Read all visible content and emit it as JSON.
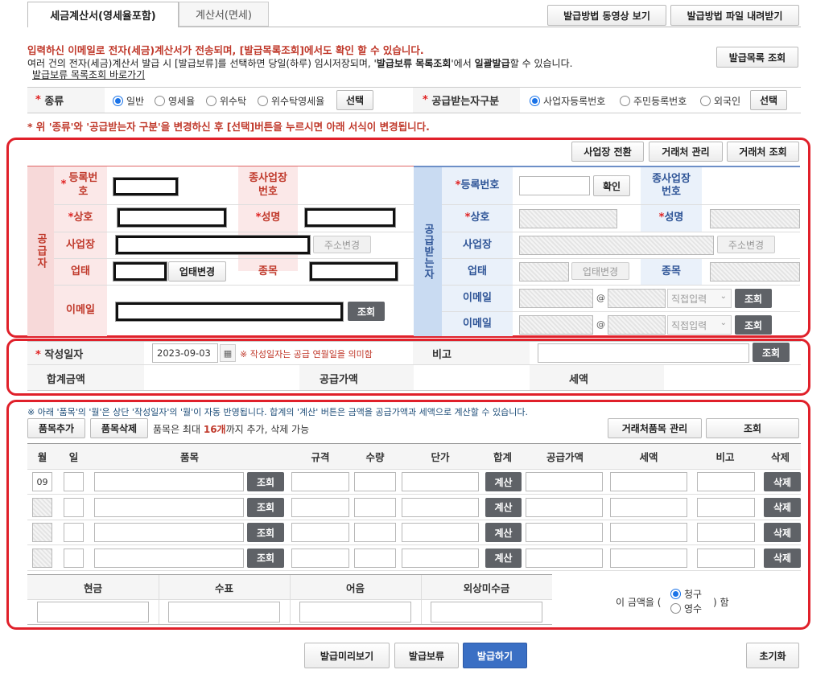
{
  "tabs": [
    {
      "label": "세금계산서(영세율포함)"
    },
    {
      "label": "계산서(면세)"
    }
  ],
  "top_buttons": {
    "video": "발급방법 동영상 보기",
    "download": "발급방법 파일 내려받기",
    "list": "발급목록 조회"
  },
  "notice": {
    "line1": "입력하신 이메일로 전자(세금)계산서가 전송되며, [발급목록조회]에서도 확인 할 수 있습니다.",
    "line2a": "여러 건의 전자(세금)계산서 발급 시 [발급보류]를 선택하면 당일(하루) 임시저장되며, '",
    "line2b": "발급보류 목록조회",
    "line2c": "'에서 ",
    "line2d": "일괄발급",
    "line2e": "할 수 있습니다.",
    "link": "발급보류 목록조회 바로가기"
  },
  "type_row": {
    "label": "종류",
    "options": [
      "일반",
      "영세율",
      "위수탁",
      "위수탁영세율"
    ],
    "selected": "일반",
    "select_button": "선택"
  },
  "receiver_type": {
    "label": "공급받는자구분",
    "options": [
      "사업자등록번호",
      "주민등록번호",
      "외국인"
    ],
    "selected": "사업자등록번호",
    "select_button": "선택"
  },
  "warning": "* 위 '종류'와 '공급받는자 구분'을 변경하신 후 [선택]버튼을 누르시면 아래 서식이 변경됩니다.",
  "party_buttons": {
    "switch": "사업장 전환",
    "manage": "거래처 관리",
    "lookup": "거래처 조회"
  },
  "supplier": {
    "side_label": "공급자",
    "reg_no": "등록번호",
    "sub_no": "종사업장번호",
    "name": "상호",
    "ceo": "성명",
    "address": "사업장",
    "addr_change": "주소변경",
    "biz_type": "업태",
    "biz_change": "업태변경",
    "item": "종목",
    "email": "이메일",
    "lookup": "조회"
  },
  "buyer": {
    "side_label": "공급받는자",
    "reg_no": "등록번호",
    "confirm": "확인",
    "sub_no": "종사업장번호",
    "name": "상호",
    "ceo": "성명",
    "address": "사업장",
    "addr_change": "주소변경",
    "biz_type": "업태",
    "biz_change": "업태변경",
    "item": "종목",
    "email": "이메일",
    "at": "@",
    "domain_select": "직접입력",
    "lookup": "조회"
  },
  "date_row": {
    "label": "작성일자",
    "value": "2023-09-03",
    "note": "※ 작성일자는 공급 연월일을 의미함",
    "remark": "비고",
    "lookup": "조회"
  },
  "sum_row": {
    "total": "합계금액",
    "supply": "공급가액",
    "tax": "세액"
  },
  "items": {
    "notice": "※ 아래 '품목'의 '월'은 상단 '작성일자'의 '월'이 자동 반영됩니다. 합계의 '계산' 버튼은 금액을 공급가액과 세액으로 계산할 수 있습니다.",
    "add": "품목추가",
    "remove": "품목삭제",
    "limit_a": "품목은 최대 ",
    "limit_b": "16개",
    "limit_c": "까지 추가, 삭제 가능",
    "manage": "거래처품목 관리",
    "lookup": "조회",
    "headers": [
      "월",
      "일",
      "품목",
      "규격",
      "수량",
      "단가",
      "합계",
      "공급가액",
      "세액",
      "비고",
      "삭제"
    ],
    "rows": [
      {
        "month": "09"
      },
      {
        "month": ""
      },
      {
        "month": ""
      },
      {
        "month": ""
      }
    ],
    "calc": "계산",
    "delete": "삭제"
  },
  "payment": {
    "headers": [
      "현금",
      "수표",
      "어음",
      "외상미수금"
    ],
    "prefix": "이 금액을 (",
    "options": [
      "청구",
      "영수"
    ],
    "selected": "청구",
    "suffix": ") 함"
  },
  "bottom": {
    "preview": "발급미리보기",
    "hold": "발급보류",
    "issue": "발급하기",
    "reset": "초기화"
  },
  "colors": {
    "accent_red": "#e0202a",
    "issue_blue": "#3a6fc4",
    "supplier_bg": "#fbe8e8",
    "buyer_bg": "#d6e4f5"
  }
}
